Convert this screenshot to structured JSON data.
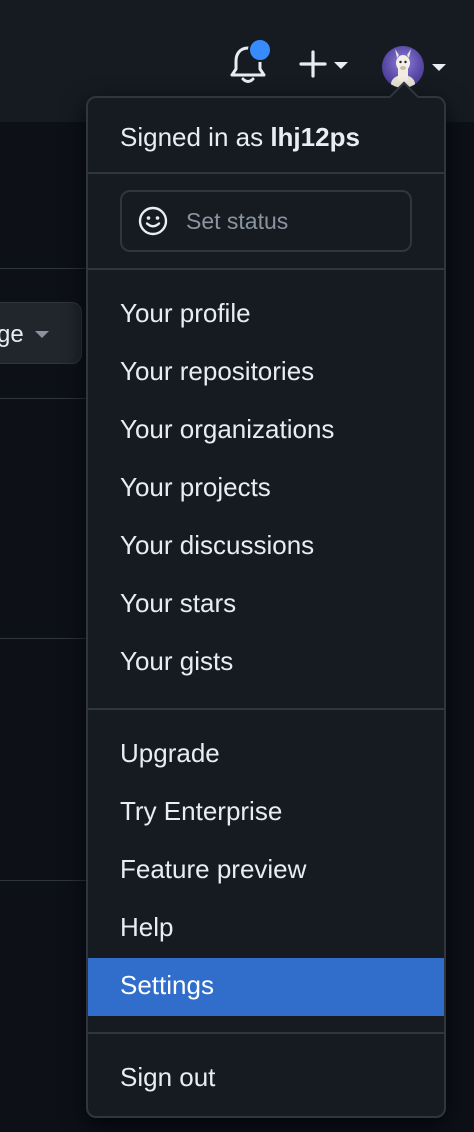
{
  "header": {
    "notifications_icon": "bell-icon",
    "create_icon": "plus-icon",
    "avatar_alt": "llama avatar"
  },
  "background": {
    "button_label": "ge"
  },
  "dropdown": {
    "signed_in_prefix": "Signed in as ",
    "username": "lhj12ps",
    "set_status_label": "Set status",
    "section1": [
      {
        "label": "Your profile"
      },
      {
        "label": "Your repositories"
      },
      {
        "label": "Your organizations"
      },
      {
        "label": "Your projects"
      },
      {
        "label": "Your discussions"
      },
      {
        "label": "Your stars"
      },
      {
        "label": "Your gists"
      }
    ],
    "section2": [
      {
        "label": "Upgrade"
      },
      {
        "label": "Try Enterprise"
      },
      {
        "label": "Feature preview"
      },
      {
        "label": "Help"
      },
      {
        "label": "Settings",
        "active": true
      }
    ],
    "sign_out_label": "Sign out"
  },
  "colors": {
    "active_item": "#316dca",
    "notification_dot": "#388bfd"
  }
}
